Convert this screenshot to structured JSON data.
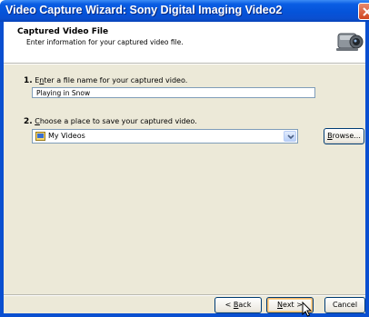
{
  "window": {
    "title": "Video Capture Wizard: Sony Digital Imaging Video2"
  },
  "header": {
    "title": "Captured Video File",
    "subtitle": "Enter information for your captured video file.",
    "icon": "camcorder-icon"
  },
  "step1": {
    "number": "1.",
    "label_pre": "E",
    "label_accel": "n",
    "label_post": "ter a file name for your captured video.",
    "filename_value": "Playing in Snow"
  },
  "step2": {
    "number": "2.",
    "label_accel": "C",
    "label_post": "hoose a place to save your captured video.",
    "location_value": "My Videos",
    "location_icon": "folder-icon",
    "browse_accel": "B",
    "browse_post": "rowse..."
  },
  "buttons": {
    "back_pre": "< ",
    "back_accel": "B",
    "back_post": "ack",
    "next_accel": "N",
    "next_post": "ext >",
    "cancel": "Cancel"
  },
  "colors": {
    "titlebar": "#0553d9",
    "dialog_bg": "#ece9d8",
    "close_button": "#d0451f"
  }
}
